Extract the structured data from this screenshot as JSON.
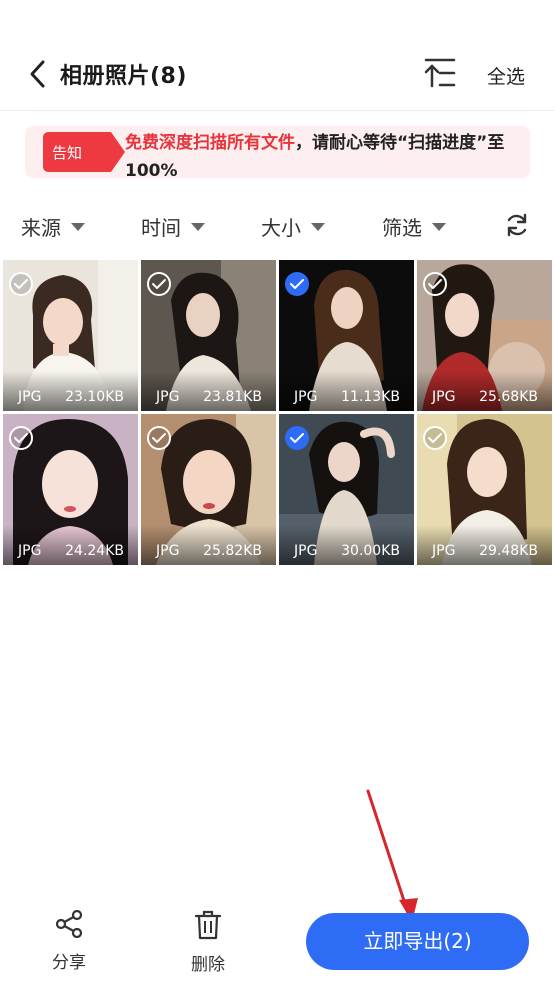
{
  "header": {
    "title": "相册照片(8)",
    "select_all_label": "全选"
  },
  "notice": {
    "badge_label": "告知",
    "highlight": "免费深度扫描所有文件",
    "message": "，请耐心等待“扫描进度”至100%"
  },
  "filters": [
    {
      "label": "来源"
    },
    {
      "label": "时间"
    },
    {
      "label": "大小"
    },
    {
      "label": "筛选"
    }
  ],
  "photos": [
    {
      "format": "JPG",
      "size": "23.10KB",
      "selected": false
    },
    {
      "format": "JPG",
      "size": "23.81KB",
      "selected": false
    },
    {
      "format": "JPG",
      "size": "11.13KB",
      "selected": true
    },
    {
      "format": "JPG",
      "size": "25.68KB",
      "selected": false
    },
    {
      "format": "JPG",
      "size": "24.24KB",
      "selected": false
    },
    {
      "format": "JPG",
      "size": "25.82KB",
      "selected": false
    },
    {
      "format": "JPG",
      "size": "30.00KB",
      "selected": true
    },
    {
      "format": "JPG",
      "size": "29.48KB",
      "selected": false
    }
  ],
  "toolbar": {
    "share_label": "分享",
    "delete_label": "删除",
    "export_label": "立即导出(2)"
  },
  "colors": {
    "accent": "#2e6cf5",
    "notice_red": "#e8343b",
    "notice_bg": "#fdeff0"
  }
}
